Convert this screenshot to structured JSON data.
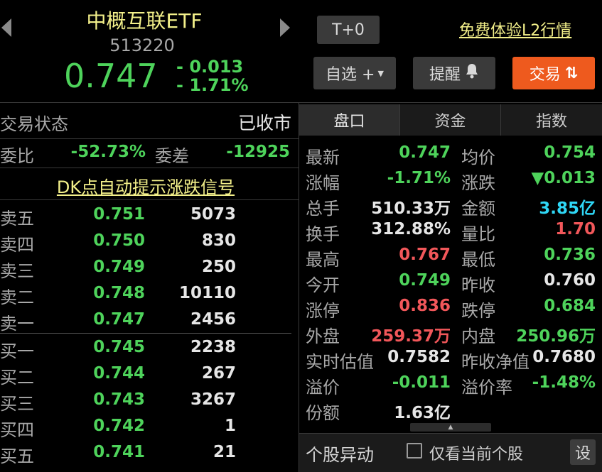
{
  "header": {
    "name": "中概互联ETF",
    "code": "513220",
    "price": "0.747",
    "change": "- 0.013",
    "change_pct": "- 1.71%",
    "t0_label": "T+0",
    "l2_link": "免费体验L2行情",
    "watchlist_label": "自选 +",
    "alert_label": "提醒",
    "trade_label": "交易",
    "colors": {
      "down": "#4ed35b",
      "up": "#f2575a",
      "trade_bg": "#ee5a1e",
      "link": "#f3f08a"
    }
  },
  "status": {
    "label": "交易状态",
    "value": "已收市",
    "ratio_label": "委比",
    "ratio_value": "-52.73%",
    "diff_label": "委差",
    "diff_value": "-12925",
    "dk_link": "DK点自动提示涨跌信号"
  },
  "orderbook": {
    "sell": [
      {
        "label": "卖五",
        "price": "0.751",
        "volume": "5073"
      },
      {
        "label": "卖四",
        "price": "0.750",
        "volume": "830"
      },
      {
        "label": "卖三",
        "price": "0.749",
        "volume": "250"
      },
      {
        "label": "卖二",
        "price": "0.748",
        "volume": "10110"
      },
      {
        "label": "卖一",
        "price": "0.747",
        "volume": "2456"
      }
    ],
    "buy": [
      {
        "label": "买一",
        "price": "0.745",
        "volume": "2238"
      },
      {
        "label": "买二",
        "price": "0.744",
        "volume": "267"
      },
      {
        "label": "买三",
        "price": "0.743",
        "volume": "3267"
      },
      {
        "label": "买四",
        "price": "0.742",
        "volume": "1"
      },
      {
        "label": "买五",
        "price": "0.741",
        "volume": "21"
      }
    ]
  },
  "tabs": [
    "盘口",
    "资金",
    "指数"
  ],
  "quote": {
    "left": [
      {
        "label": "最新",
        "value": "0.747",
        "color": "green"
      },
      {
        "label": "涨幅",
        "value": "-1.71%",
        "color": "green"
      },
      {
        "label": "总手",
        "value": "510.33万",
        "color": "white"
      },
      {
        "label": "换手",
        "value": "312.88%",
        "color": "white"
      },
      {
        "label": "最高",
        "value": "0.767",
        "color": "red"
      },
      {
        "label": "今开",
        "value": "0.749",
        "color": "green"
      },
      {
        "label": "涨停",
        "value": "0.836",
        "color": "red"
      },
      {
        "label": "外盘",
        "value": "259.37万",
        "color": "red"
      },
      {
        "label": "实时估值",
        "value": "0.7582",
        "color": "white"
      },
      {
        "label": "溢价",
        "value": "-0.011",
        "color": "green"
      },
      {
        "label": "份额",
        "value": "1.63亿",
        "color": "white"
      }
    ],
    "right": [
      {
        "label": "均价",
        "value": "0.754",
        "color": "green"
      },
      {
        "label": "涨跌",
        "value": "▼0.013",
        "color": "green"
      },
      {
        "label": "金额",
        "value": "3.85亿",
        "color": "cyan"
      },
      {
        "label": "量比",
        "value": "1.70",
        "color": "red"
      },
      {
        "label": "最低",
        "value": "0.736",
        "color": "green"
      },
      {
        "label": "昨收",
        "value": "0.760",
        "color": "white"
      },
      {
        "label": "跌停",
        "value": "0.684",
        "color": "green"
      },
      {
        "label": "内盘",
        "value": "250.96万",
        "color": "green"
      },
      {
        "label": "昨收净值",
        "value": "0.7680",
        "color": "white"
      },
      {
        "label": "溢价率",
        "value": "-1.48%",
        "color": "green"
      }
    ]
  },
  "bottom": {
    "title": "个股异动",
    "checkbox_label": "仅看当前个股",
    "settings_label": "设"
  }
}
